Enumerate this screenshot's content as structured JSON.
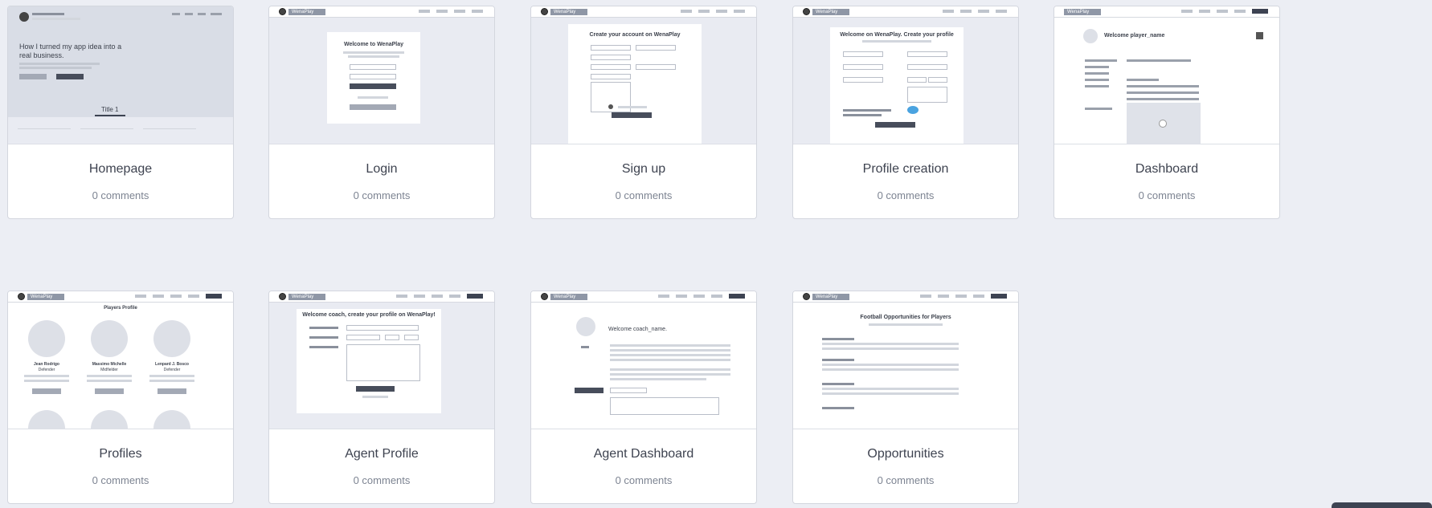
{
  "cards": [
    {
      "title": "Homepage",
      "comments": "0 comments"
    },
    {
      "title": "Login",
      "comments": "0 comments"
    },
    {
      "title": "Sign up",
      "comments": "0 comments"
    },
    {
      "title": "Profile creation",
      "comments": "0 comments"
    },
    {
      "title": "Dashboard",
      "comments": "0 comments"
    },
    {
      "title": "Profiles",
      "comments": "0 comments"
    },
    {
      "title": "Agent Profile",
      "comments": "0 comments"
    },
    {
      "title": "Agent Dashboard",
      "comments": "0 comments"
    },
    {
      "title": "Opportunities",
      "comments": "0 comments"
    }
  ],
  "thumbs": {
    "home_heading": "How I turned my app idea into a real business.",
    "home_tab": "Title 1",
    "login_heading": "Welcome to WenaPlay",
    "signup_heading": "Create your account on WenaPlay",
    "profile_heading": "Welcome on WenaPlay. Create your profile",
    "dash_heading": "Welcome player_name",
    "profiles_heading": "Players Profile",
    "profiles_players": [
      {
        "name": "Jean Rodrigo",
        "role": "Defender"
      },
      {
        "name": "Massimo Michelle",
        "role": "Midfielder"
      },
      {
        "name": "Lenpard J. Bosco",
        "role": "Defender"
      }
    ],
    "agent_heading": "Welcome coach, create your profile on WenaPlay!",
    "agentdash_heading": "Welcome coach_name.",
    "opps_heading": "Football Opportunities for Players",
    "brand": "WenaPlay"
  }
}
